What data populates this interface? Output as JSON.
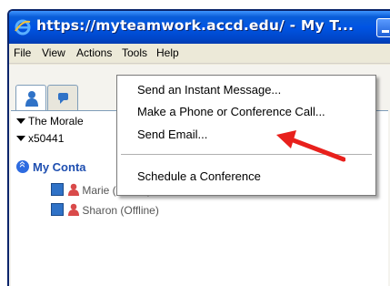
{
  "window": {
    "title": "https://myteamwork.accd.edu/ - My T..."
  },
  "menubar": {
    "items": [
      "File",
      "View",
      "Actions",
      "Tools",
      "Help"
    ]
  },
  "rows": {
    "morale": "The Morale",
    "extension": "x50441",
    "group_title": "My Conta"
  },
  "contacts": [
    {
      "name": "Marie (Offline)"
    },
    {
      "name": "Sharon (Offline)"
    }
  ],
  "dropdown": {
    "items": [
      "Send an Instant Message...",
      "Make a Phone or Conference Call...",
      "Send Email...",
      "Schedule a Conference"
    ]
  },
  "colors": {
    "titlebar": "#0054e3",
    "accent": "#1f4fb0",
    "arrow": "#e8201c",
    "offline_person": "#d94a4a"
  }
}
